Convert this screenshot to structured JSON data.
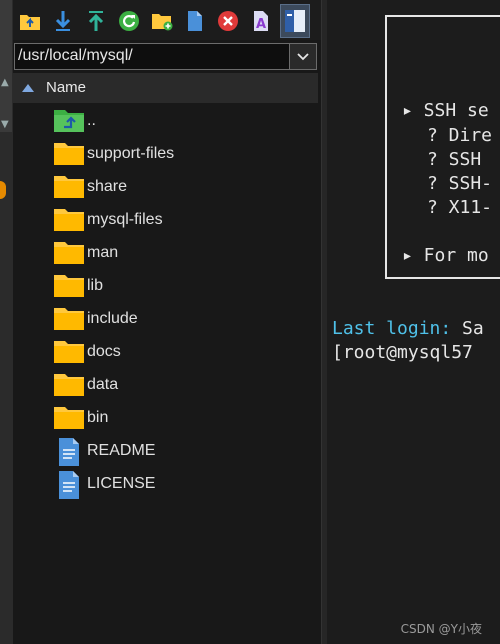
{
  "file_panel": {
    "path": "/usr/local/mysql/",
    "column_header": "Name",
    "items": [
      {
        "name": "..",
        "type": "parent"
      },
      {
        "name": "support-files",
        "type": "folder"
      },
      {
        "name": "share",
        "type": "folder"
      },
      {
        "name": "mysql-files",
        "type": "folder"
      },
      {
        "name": "man",
        "type": "folder"
      },
      {
        "name": "lib",
        "type": "folder"
      },
      {
        "name": "include",
        "type": "folder"
      },
      {
        "name": "docs",
        "type": "folder"
      },
      {
        "name": "data",
        "type": "folder"
      },
      {
        "name": "bin",
        "type": "folder"
      },
      {
        "name": "README",
        "type": "file"
      },
      {
        "name": "LICENSE",
        "type": "file"
      }
    ],
    "toolbar_icons": [
      "folder-up-icon",
      "download-icon",
      "upload-icon",
      "refresh-icon",
      "new-folder-icon",
      "new-file-icon",
      "delete-icon",
      "rename-icon",
      "panel-view-icon"
    ]
  },
  "terminal": {
    "banner_lines": [
      "▸ SSH se",
      "? Dire",
      "? SSH",
      "? SSH-",
      "? X11-",
      "▸ For mo"
    ],
    "last_login_key": "Last login:",
    "last_login_value": " Sa",
    "prompt": "[root@mysql57"
  },
  "watermark": "CSDN @Y小夜",
  "colors": {
    "folder": "#ffc83d",
    "file": "#4a90d9",
    "accent": "#4fc1e9"
  }
}
